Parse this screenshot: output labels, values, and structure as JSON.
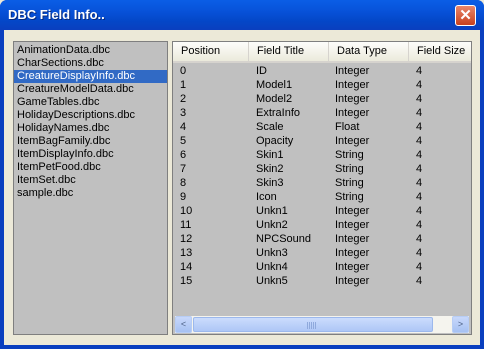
{
  "window": {
    "title": "DBC Field Info..",
    "close_glyph": "✕"
  },
  "files": [
    "AnimationData.dbc",
    "CharSections.dbc",
    "CreatureDisplayInfo.dbc",
    "CreatureModelData.dbc",
    "GameTables.dbc",
    "HolidayDescriptions.dbc",
    "HolidayNames.dbc",
    "ItemBagFamily.dbc",
    "ItemDisplayInfo.dbc",
    "ItemPetFood.dbc",
    "ItemSet.dbc",
    "sample.dbc"
  ],
  "selected_file": "CreatureDisplayInfo.dbc",
  "grid": {
    "columns": [
      "Position",
      "Field Title",
      "Data Type",
      "Field Size"
    ],
    "rows": [
      [
        "0",
        "ID",
        "Integer",
        "4"
      ],
      [
        "1",
        "Model1",
        "Integer",
        "4"
      ],
      [
        "2",
        "Model2",
        "Integer",
        "4"
      ],
      [
        "3",
        "ExtraInfo",
        "Integer",
        "4"
      ],
      [
        "4",
        "Scale",
        "Float",
        "4"
      ],
      [
        "5",
        "Opacity",
        "Integer",
        "4"
      ],
      [
        "6",
        "Skin1",
        "String",
        "4"
      ],
      [
        "7",
        "Skin2",
        "String",
        "4"
      ],
      [
        "8",
        "Skin3",
        "String",
        "4"
      ],
      [
        "9",
        "Icon",
        "String",
        "4"
      ],
      [
        "10",
        "Unkn1",
        "Integer",
        "4"
      ],
      [
        "11",
        "Unkn2",
        "Integer",
        "4"
      ],
      [
        "12",
        "NPCSound",
        "Integer",
        "4"
      ],
      [
        "13",
        "Unkn3",
        "Integer",
        "4"
      ],
      [
        "14",
        "Unkn4",
        "Integer",
        "4"
      ],
      [
        "15",
        "Unkn5",
        "Integer",
        "4"
      ]
    ]
  },
  "scrollbar": {
    "left_arrow": "<",
    "right_arrow": ">"
  },
  "colors": {
    "titlebar": "#0a5ee6",
    "selection": "#316ac5",
    "list_bg": "#c0c0c0",
    "close": "#c8411d"
  },
  "icons": [
    "close-icon",
    "scroll-left-icon",
    "scroll-right-icon",
    "scroll-grip-icon"
  ]
}
